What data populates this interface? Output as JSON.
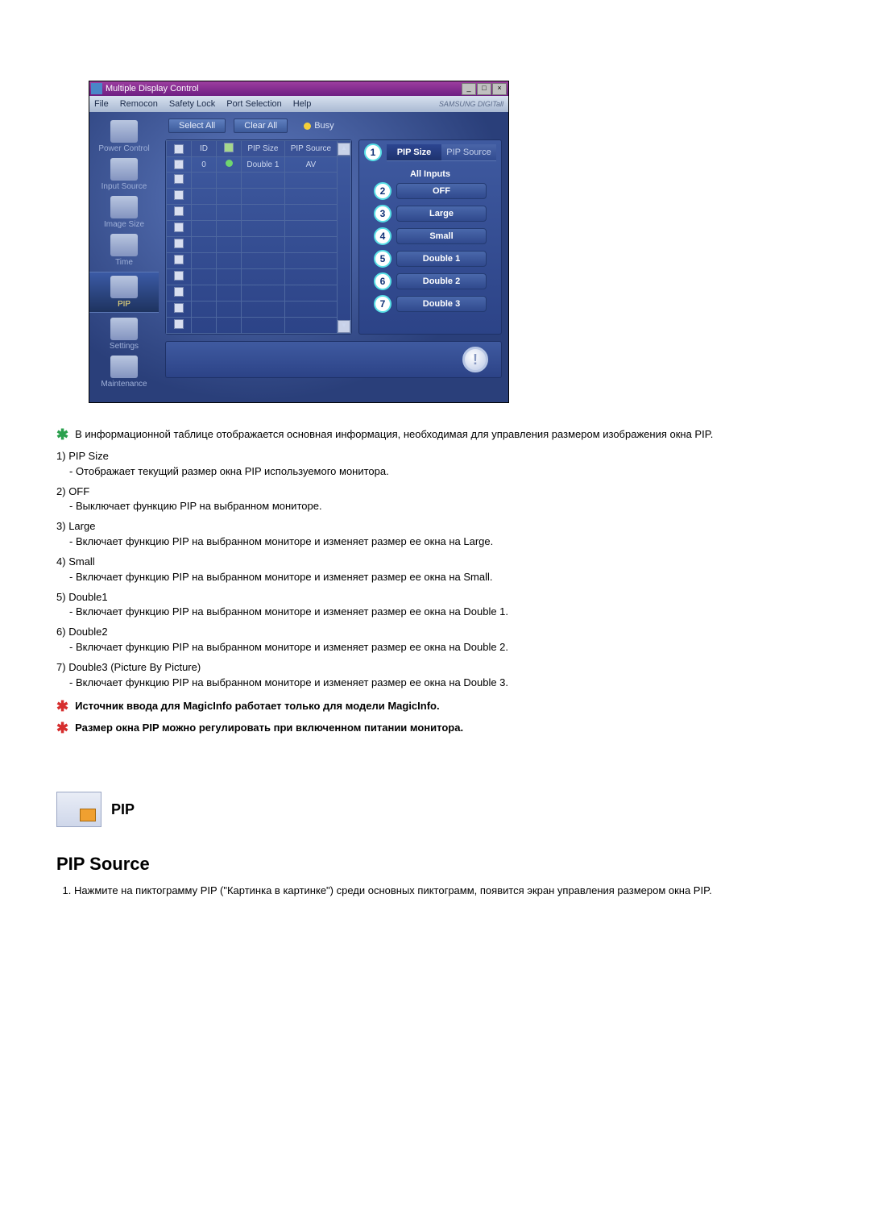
{
  "app": {
    "title": "Multiple Display Control",
    "menus": [
      "File",
      "Remocon",
      "Safety Lock",
      "Port Selection",
      "Help"
    ],
    "brand": "SAMSUNG DIGITall"
  },
  "sidebar": {
    "items": [
      {
        "label": "Power Control"
      },
      {
        "label": "Input Source"
      },
      {
        "label": "Image Size"
      },
      {
        "label": "Time"
      },
      {
        "label": "PIP"
      },
      {
        "label": "Settings"
      },
      {
        "label": "Maintenance"
      }
    ]
  },
  "toolbar": {
    "select_all": "Select All",
    "clear_all": "Clear All",
    "busy": "Busy"
  },
  "grid": {
    "cols": {
      "chk": "☑",
      "id": "ID",
      "stat": "⬤",
      "pip_size": "PIP Size",
      "pip_source": "PIP Source"
    },
    "row0": {
      "id": "0",
      "pip_size": "Double 1",
      "pip_source": "AV"
    }
  },
  "panel": {
    "tabs": {
      "size": "PIP Size",
      "source": "PIP Source"
    },
    "all_inputs": "All Inputs",
    "options": [
      {
        "n": "2",
        "label": "OFF"
      },
      {
        "n": "3",
        "label": "Large"
      },
      {
        "n": "4",
        "label": "Small"
      },
      {
        "n": "5",
        "label": "Double 1"
      },
      {
        "n": "6",
        "label": "Double 2"
      },
      {
        "n": "7",
        "label": "Double 3"
      }
    ],
    "callout1": "1"
  },
  "doc": {
    "star1": "В информационной таблице отображается основная информация, необходимая для управления размером изображения окна PIP.",
    "items": [
      {
        "n": "1)",
        "title": "PIP Size",
        "desc": "- Отображает текущий размер окна PIP используемого монитора."
      },
      {
        "n": "2)",
        "title": "OFF",
        "desc": "- Выключает функцию PIP на выбранном мониторе."
      },
      {
        "n": "3)",
        "title": "Large",
        "desc": "- Включает функцию PIP на выбранном мониторе и изменяет размер ее окна на Large."
      },
      {
        "n": "4)",
        "title": "Small",
        "desc": "- Включает функцию PIP на выбранном мониторе и изменяет размер ее окна на Small."
      },
      {
        "n": "5)",
        "title": "Double1",
        "desc": "- Включает функцию PIP на выбранном мониторе и изменяет размер ее окна на Double 1."
      },
      {
        "n": "6)",
        "title": "Double2",
        "desc": "- Включает функцию PIP на выбранном мониторе и изменяет размер ее окна на Double 2."
      },
      {
        "n": "7)",
        "title": "Double3 (Picture By Picture)",
        "desc": "- Включает функцию PIP на выбранном мониторе и изменяет размер ее окна на Double 3."
      }
    ],
    "note1": "Источник ввода для MagicInfo работает только для модели MagicInfo.",
    "note2": "Размер окна PIP можно регулировать при включенном питании монитора.",
    "section_label": "PIP",
    "subheading": "PIP Source",
    "step1": "Нажмите на пиктограмму PIP (\"Картинка в картинке\") среди основных пиктограмм, появится экран управления размером окна PIP."
  }
}
